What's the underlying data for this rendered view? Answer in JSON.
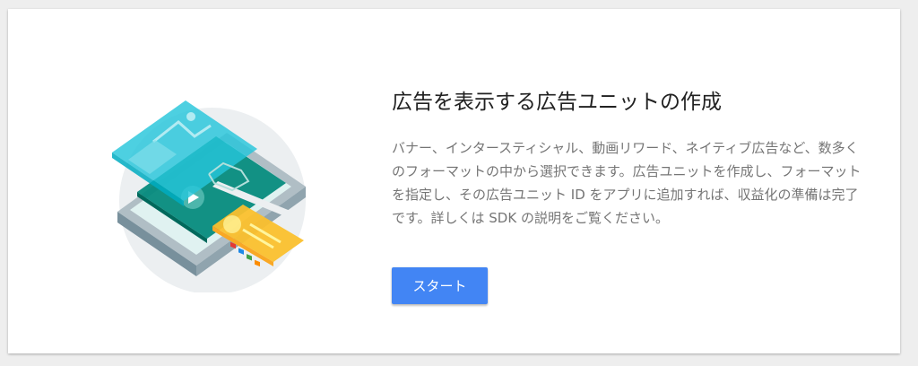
{
  "card": {
    "title": "広告を表示する広告ユニットの作成",
    "description": "バナー、インタースティシャル、動画リワード、ネイティブ広告など、数多くのフォーマットの中から選択できます。広告ユニットを作成し、フォーマットを指定し、その広告ユニット ID をアプリに追加すれば、収益化の準備は完了です。詳しくは SDK の説明をご覧ください。",
    "button_label": "スタート"
  },
  "colors": {
    "button": "#4285f4",
    "teal": "#26a69a",
    "teal_light": "#4dd0e1",
    "yellow": "#fbc02d",
    "circle": "#eceff1"
  },
  "icons": {
    "illustration": "ad-formats-illustration"
  }
}
